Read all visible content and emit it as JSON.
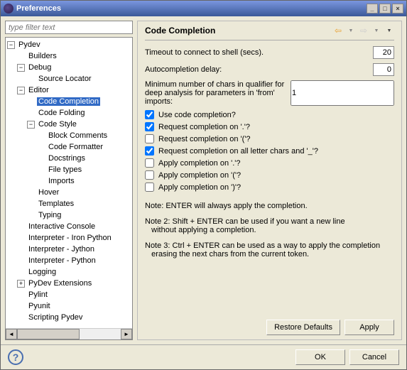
{
  "window": {
    "title": "Preferences"
  },
  "filter": {
    "placeholder": "type filter text"
  },
  "tree": {
    "n0": "Pydev",
    "n1": "Builders",
    "n2": "Debug",
    "n3": "Source Locator",
    "n4": "Editor",
    "n5": "Code Completion",
    "n6": "Code Folding",
    "n7": "Code Style",
    "n8": "Block Comments",
    "n9": "Code Formatter",
    "n10": "Docstrings",
    "n11": "File types",
    "n12": "Imports",
    "n13": "Hover",
    "n14": "Templates",
    "n15": "Typing",
    "n16": "Interactive Console",
    "n17": "Interpreter - Iron Python",
    "n18": "Interpreter - Jython",
    "n19": "Interpreter - Python",
    "n20": "Logging",
    "n21": "PyDev Extensions",
    "n22": "Pylint",
    "n23": "Pyunit",
    "n24": "Scripting Pydev"
  },
  "page": {
    "title": "Code Completion",
    "timeout_label": "Timeout to connect to shell (secs).",
    "timeout_value": "20",
    "delay_label": "Autocompletion delay:",
    "delay_value": "0",
    "minchars_label1": "Minimum number of chars in qualifier for",
    "minchars_label2": "deep analysis for parameters in 'from' imports:",
    "minchars_value": "1",
    "checks": {
      "c0": "Use code completion?",
      "c1": "Request completion on '.'?",
      "c2": "Request completion on '('?",
      "c3": "Request completion on all letter chars and '_'?",
      "c4": "Apply completion on '.'?",
      "c5": "Apply completion on '('?",
      "c6": "Apply completion on ')'?"
    },
    "note1": "Note: ENTER will always apply the completion.",
    "note2a": "Note 2: Shift + ENTER can be used if you want a new line",
    "note2b": "without applying a completion.",
    "note3a": "Note 3: Ctrl + ENTER can be used as a way to apply the completion",
    "note3b": "erasing the next chars from the current token."
  },
  "buttons": {
    "restore": "Restore Defaults",
    "apply": "Apply",
    "ok": "OK",
    "cancel": "Cancel"
  }
}
